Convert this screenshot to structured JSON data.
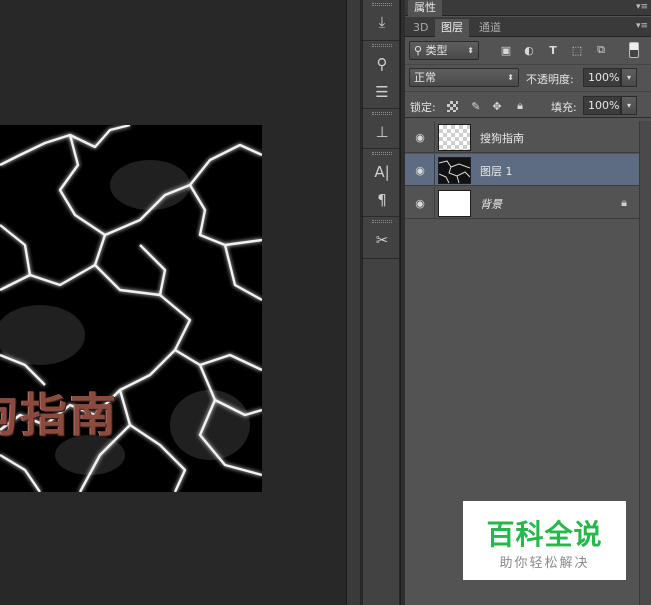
{
  "canvas": {
    "text_fragment": "狗指南"
  },
  "properties_panel": {
    "tab_label": "属性"
  },
  "tabs": [
    {
      "label": "3D",
      "active": false
    },
    {
      "label": "图层",
      "active": true
    },
    {
      "label": "通道",
      "active": false
    }
  ],
  "filter": {
    "kind_label": "类型",
    "icons": [
      "image-filter-icon",
      "adjustment-filter-icon",
      "type-filter-icon",
      "shape-filter-icon",
      "smart-object-filter-icon",
      "filter-toggle-icon"
    ]
  },
  "blend": {
    "mode": "正常",
    "opacity_label": "不透明度:",
    "opacity_value": "100%"
  },
  "lock": {
    "label": "锁定:",
    "fill_label": "填充:",
    "fill_value": "100%"
  },
  "layers": [
    {
      "name": "搜狗指南",
      "thumbnail": "transparent",
      "selected": false,
      "locked": false
    },
    {
      "name": "图层 1",
      "thumbnail": "clouds",
      "selected": true,
      "locked": false
    },
    {
      "name": "背景",
      "thumbnail": "white",
      "selected": false,
      "locked": true
    }
  ],
  "watermark": {
    "title": "百科全说",
    "subtitle": "助你轻松解决"
  },
  "colors": {
    "panel_bg": "#535353",
    "selected_layer": "#5d6c80",
    "watermark_green": "#26b84a"
  }
}
